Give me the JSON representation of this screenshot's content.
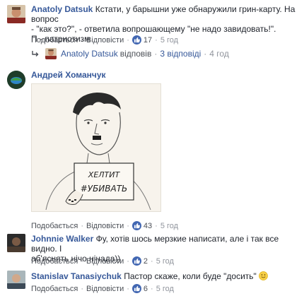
{
  "c1": {
    "author": "Anatoly Datsuk",
    "text_line1": "Кстати, у барышни уже обнаружили грин-карту. На вопрос",
    "text_line2": "- \"как это?\", - ответила вопрошающему \"не надо завидовать!\".",
    "text_line3": "П - патриотизм",
    "like_label": "Подобається",
    "reply_label": "Відповісти",
    "likes": "17",
    "time": "5 год"
  },
  "c1_reply": {
    "author": "Anatoly Datsuk",
    "verb": "відповів",
    "count": "3 відповіді",
    "time": "4 год"
  },
  "c2": {
    "author": "Андрей Хоманчук",
    "image_caption_1": "ХЕЛТИТ",
    "image_caption_2": "#УБИВАТЬ",
    "like_label": "Подобається",
    "reply_label": "Відповісти",
    "likes": "43",
    "time": "5 год"
  },
  "c3": {
    "author": "Johnnie Walker",
    "text_line1": "Фу, хотів шось мерзкие написати, але і так все видно. І",
    "text_line2": "аб'яснять нічо нінада))",
    "like_label": "Подобається",
    "reply_label": "Відповісти",
    "likes": "2",
    "time": "5 год"
  },
  "c4": {
    "author": "Stanislav Tanasiychuk",
    "text": "Пастор скаже, коли буде \"досить\"",
    "like_label": "Подобається",
    "reply_label": "Відповісти",
    "likes": "6",
    "time": "5 год"
  },
  "colors": {
    "link": "#365899",
    "meta": "#90949c",
    "like_badge": "#4267b2"
  },
  "icons": [
    "like-thumb-icon",
    "reply-arrow-icon",
    "smile-emoji-icon"
  ]
}
